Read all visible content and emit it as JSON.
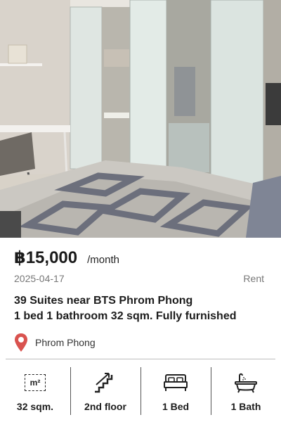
{
  "listing": {
    "price": "฿15,000",
    "per": "/month",
    "date": "2025-04-17",
    "type": "Rent",
    "title_line1": "39 Suites near BTS Phrom Phong",
    "title_line2": "1 bed 1 bathroom 32 sqm. Fully furnished",
    "location": "Phrom Phong"
  },
  "features": {
    "area_symbol": "m²",
    "area": "32 sqm.",
    "floor": "2nd floor",
    "beds": "1 Bed",
    "baths": "1 Bath"
  },
  "icons": {
    "location": "map-pin-icon",
    "area": "area-square-meter-icon",
    "floor": "stairs-icon",
    "bed": "bed-icon",
    "bath": "bathtub-icon"
  },
  "colors": {
    "pin": "#d9534f",
    "text": "#1c1c1c",
    "muted": "#777777"
  }
}
